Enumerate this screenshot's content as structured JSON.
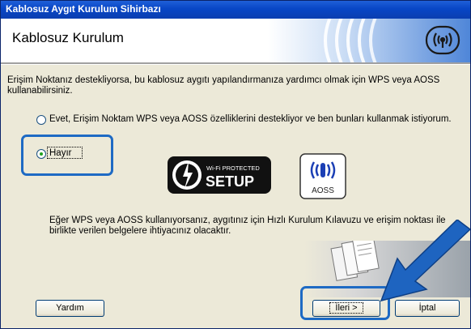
{
  "window": {
    "title": "Kablosuz Aygıt Kurulum Sihirbazı"
  },
  "header": {
    "title": "Kablosuz Kurulum"
  },
  "intro_text": "Erişim Noktanız destekliyorsa, bu kablosuz aygıtı yapılandırmanıza yardımcı olmak için WPS veya AOSS kullanabilirsiniz.",
  "options": [
    {
      "label": "Evet, Erişim Noktam WPS veya AOSS özelliklerini destekliyor ve ben bunları kullanmak istiyorum.",
      "selected": false
    },
    {
      "label": "Hayır",
      "selected": true
    }
  ],
  "logos": {
    "wps_top": "Wi-Fi PROTECTED",
    "wps_bottom": "SETUP",
    "aoss": "AOSS"
  },
  "info_text": "Eğer WPS veya AOSS kullanıyorsanız, aygıtınız için Hızlı Kurulum Kılavuzu ve erişim noktası ile birlikte verilen belgelere ihtiyacınız olacaktır.",
  "buttons": {
    "help": "Yardım",
    "next": "İleri >",
    "cancel": "İptal"
  },
  "colors": {
    "titlebar": "#0a3eb0",
    "highlight": "#1e6ac4",
    "arrow": "#1e64c0",
    "face": "#ece9d8"
  }
}
